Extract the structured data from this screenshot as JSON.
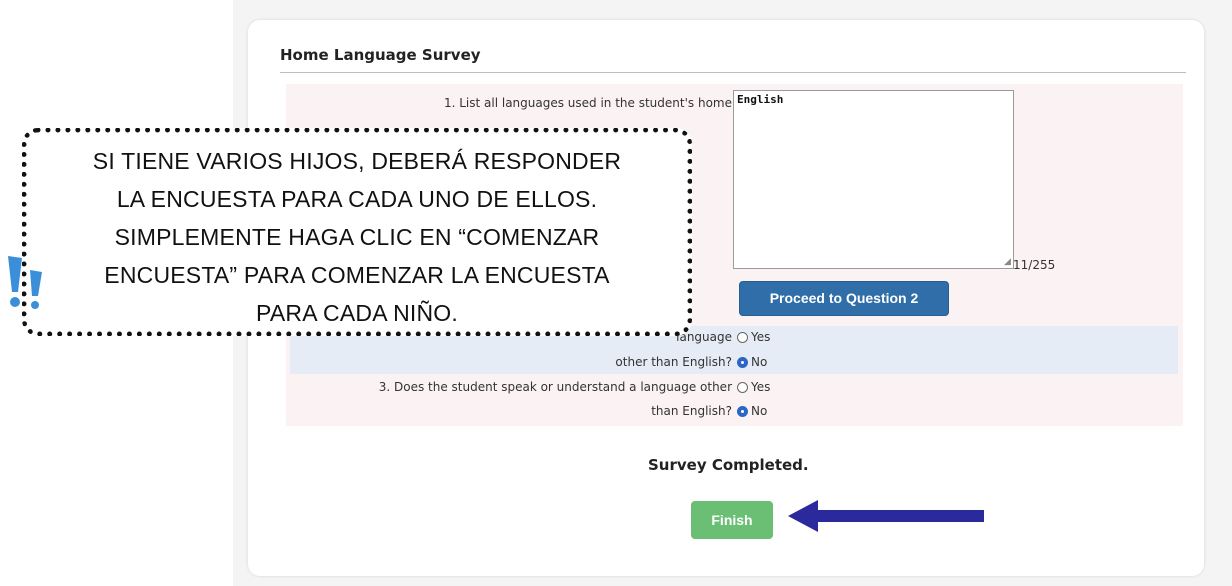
{
  "survey": {
    "title": "Home Language Survey",
    "q1": {
      "label": "1. List all languages used in the student's home",
      "answer": "English",
      "char_count": "11/255",
      "proceed_label": "Proceed to Question 2"
    },
    "q2": {
      "label_line1": "language",
      "label_line2": "other than English?",
      "options": [
        "Yes",
        "No"
      ],
      "selected": "No"
    },
    "q3": {
      "label_line1": "3. Does the student speak or understand a language other",
      "label_line2": "than English?",
      "options": [
        "Yes",
        "No"
      ],
      "selected": "No"
    },
    "completed_text": "Survey Completed.",
    "finish_label": "Finish"
  },
  "callout": {
    "lines": [
      "SI TIENE VARIOS HIJOS, DEBERÁ RESPONDER",
      "LA ENCUESTA PARA CADA UNO DE ELLOS.",
      "SIMPLEMENTE HAGA CLIC EN “COMENZAR",
      "ENCUESTA” PARA COMENZAR LA ENCUESTA",
      "PARA CADA NIÑO."
    ]
  },
  "colors": {
    "primary_button": "#2f6ea8",
    "finish_button": "#6bbf74",
    "arrow": "#2b2a9c",
    "exclaim": "#3a8fd8",
    "radio_selected": "#2b66c8"
  },
  "icons": {
    "arrow": "left-arrow-icon",
    "exclamation": "double-exclamation-icon"
  }
}
